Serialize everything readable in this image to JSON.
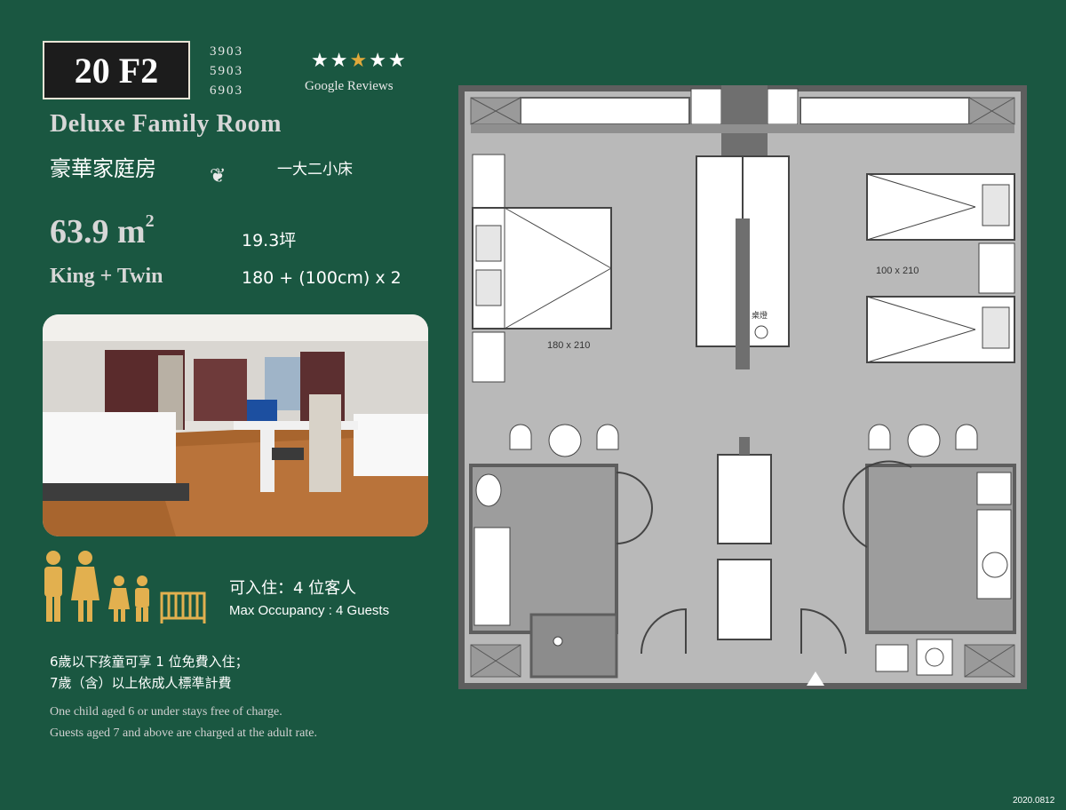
{
  "floor_badge": "20 F2",
  "room_numbers": [
    "3903",
    "5903",
    "6903"
  ],
  "rating": {
    "stars": "★★★★★",
    "label": "Google  Reviews"
  },
  "title_en": "Deluxe Family Room",
  "title_zh": "豪華家庭房",
  "bed_zh": "一大二小床",
  "area": {
    "value": "63.9 m",
    "sup": "2",
    "ping": "19.3坪"
  },
  "bed_en": "King + Twin",
  "bed_size": "180 + (100cm) x 2",
  "occupancy": {
    "zh": "可入住：4 位客人",
    "en": "Max Occupancy : 4 Guests"
  },
  "policy": {
    "zh_1": "6歲以下孩童可享 1 位免費入住；",
    "zh_2": "7歲（含）以上依成人標準計費",
    "en_1": "One child aged 6 or under stays free of charge.",
    "en_2": "Guests aged 7 and above are charged at the adult rate."
  },
  "plan": {
    "king_bed_label": "180 x 210",
    "twin_bed_label": "100 x 210",
    "desk_label": "桌燈"
  },
  "version": "2020.0812",
  "colors": {
    "background": "#1a5741",
    "floor": "#b9b9b9",
    "wall": "#6f6f6f",
    "star_accent": "#e0a93b",
    "figure": "#e2b04f"
  },
  "icons": [
    "adult-male-icon",
    "adult-female-icon",
    "child-girl-icon",
    "child-boy-icon",
    "crib-icon"
  ]
}
